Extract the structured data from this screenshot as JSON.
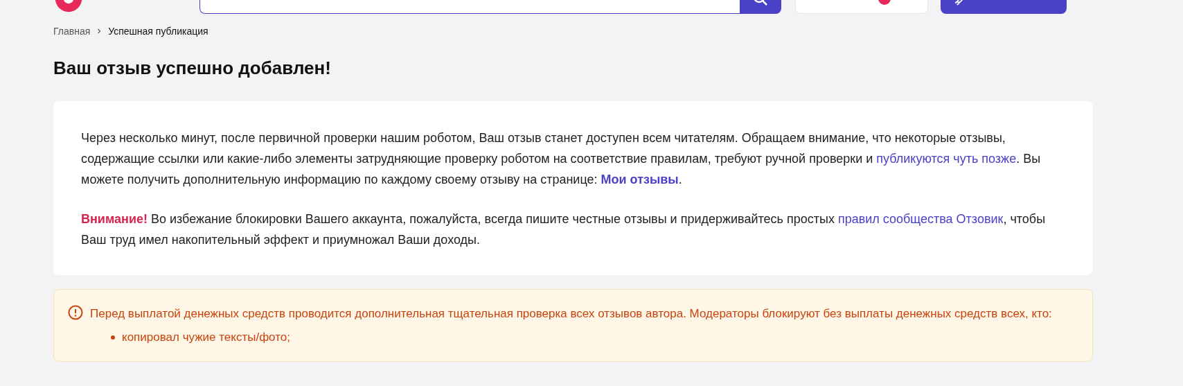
{
  "breadcrumbs": [
    {
      "label": "Главная",
      "link": true
    },
    {
      "label": "Успешная публикация",
      "link": false
    }
  ],
  "title": "Ваш отзыв успешно добавлен!",
  "card": {
    "paragraphs": [
      {
        "kind": "text",
        "text": "Через несколько минут, после первичной проверки нашим роботом, Ваш отзыв станет доступен всем читателям. Обращаем внимание, что некоторые отзывы, содержащие ссылки или какие-либо элементы затрудняющие проверку роботом на соответствие правилам, требуют ручной проверки и ",
        "link": "публикуются чуть позже",
        "after": ". Вы можете получить дополнительную информацию по каждому своему отзыву на странице: ",
        "bold_link": "Мои отзывы",
        "end": "."
      },
      {
        "kind": "warning",
        "lead": "Внимание!",
        "text": " Во избежание блокировки Вашего аккаунта, пожалуйста, всегда пишите честные отзывы и придерживайтесь простых ",
        "link": "правил сообщества Отзовик",
        "after": ", чтобы Ваш труд имел накопительный эффект и приумножал Ваши доходы."
      }
    ]
  },
  "notice": {
    "text": "Перед выплатой денежных средств проводится дополнительная тщательная проверка всех отзывов автора. Модераторы блокируют без выплаты денежных средств всех, кто:",
    "items": [
      "копировал чужие тексты/фото;"
    ]
  }
}
